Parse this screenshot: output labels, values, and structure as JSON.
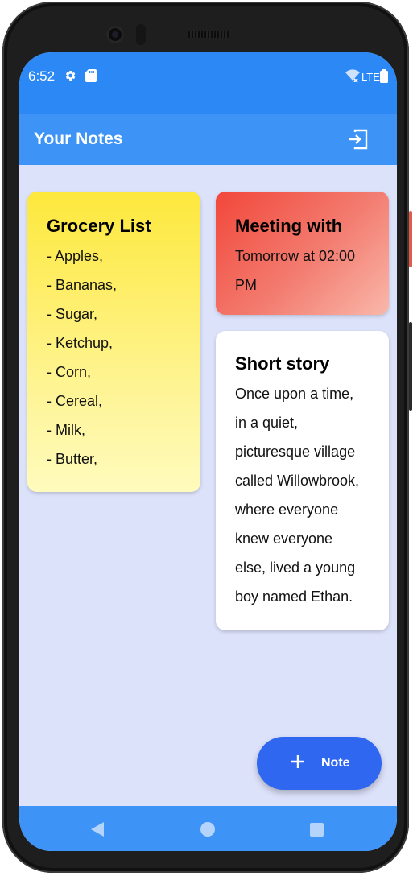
{
  "status_bar": {
    "time": "6:52",
    "network": "LTE",
    "icons": [
      "settings-icon",
      "sd-card-icon",
      "wifi-icon",
      "signal-icon",
      "battery-icon"
    ]
  },
  "app_bar": {
    "title": "Your Notes",
    "logout_icon": "logout-icon"
  },
  "notes": [
    {
      "title": "Grocery List",
      "lines": [
        "- Apples,",
        "- Bananas,",
        "- Sugar,",
        "- Ketchup,",
        "- Corn,",
        "- Cereal,",
        "- Milk,",
        "- Butter,"
      ],
      "color_top": "#fde83c",
      "color_bottom": "#fffbbd"
    },
    {
      "title": "Meeting with",
      "lines": [
        "Tomorrow at 02:00",
        "PM"
      ],
      "color_start": "#f2473a",
      "color_end": "#f9b8aa"
    },
    {
      "title": "Short story",
      "lines": [
        "Once upon a time,",
        "in a quiet,",
        "picturesque village",
        "called Willowbrook,",
        "where everyone",
        "knew everyone",
        "else, lived a young",
        "boy named Ethan."
      ],
      "color": "#ffffff"
    }
  ],
  "fab": {
    "icon": "plus-icon",
    "label": "Note",
    "color": "#2f67f1"
  },
  "nav_bar": {
    "icons": [
      "back-icon",
      "home-icon",
      "recents-icon"
    ]
  },
  "colors": {
    "status_bar": "#2b88f5",
    "app_bar": "#3d94f6",
    "background": "#dde2fb"
  }
}
